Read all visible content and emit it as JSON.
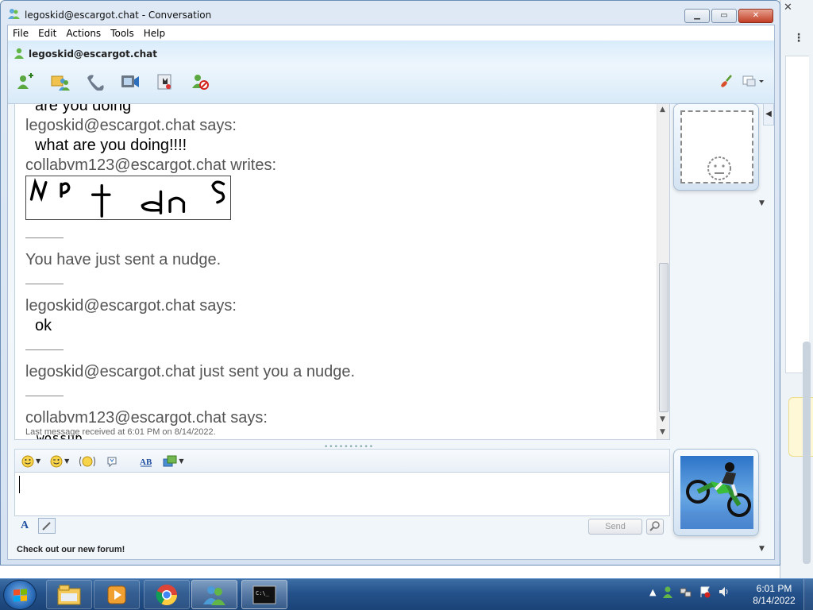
{
  "window": {
    "title": "legoskid@escargot.chat - Conversation",
    "minimize": "▁",
    "maximize": "▭",
    "close": "✕"
  },
  "menu": [
    "File",
    "Edit",
    "Actions",
    "Tools",
    "Help"
  ],
  "header": {
    "contact": "legoskid@escargot.chat"
  },
  "toolbar": {
    "icons": [
      "invite-contact-icon",
      "share-files-icon",
      "call-icon",
      "video-icon",
      "games-icon",
      "block-icon"
    ],
    "right_icons": [
      "paint-brush-icon",
      "display-options-icon"
    ]
  },
  "conversation": {
    "partial_top": "are you doing",
    "msg1_header": "legoskid@escargot.chat says:",
    "msg1_body": "what are you doing!!!!",
    "msg2_header": "collabvm123@escargot.chat writes:",
    "ink_alt": "handwritten ink message",
    "nudge_sent": "You have just sent a nudge.",
    "msg3_header": "legoskid@escargot.chat says:",
    "msg3_body": "ok",
    "nudge_received": "legoskid@escargot.chat just sent you a nudge.",
    "msg4_header": "collabvm123@escargot.chat says:",
    "msg4_body": "wossup",
    "status": "Last message received at 6:01 PM on 8/14/2022."
  },
  "compose": {
    "icons": [
      "emoticon-icon",
      "wink-icon",
      "voice-clip-icon",
      "nudge-icon",
      "font-icon",
      "background-icon"
    ],
    "send_label": "Send"
  },
  "footer": {
    "text": "Check out our new forum!"
  },
  "taskbar": {
    "items": [
      "file-explorer-icon",
      "media-player-icon",
      "chrome-icon",
      "messenger-icon",
      "command-prompt-icon"
    ],
    "time": "6:01 PM",
    "date": "8/14/2022"
  },
  "colors": {
    "accent": "#3d6ea5",
    "header_gradient": "#d9ecfb"
  }
}
